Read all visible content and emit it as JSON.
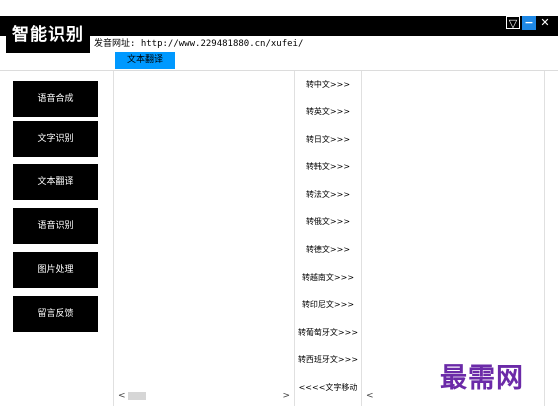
{
  "app": {
    "title": "智能识别"
  },
  "header": {
    "url_label": "发音网址: http://www.229481880.cn/xufei/"
  },
  "tab": {
    "label": "文本翻译"
  },
  "window_buttons": {
    "skin": "▽",
    "minimize": "−",
    "close": "✕"
  },
  "sidebar": {
    "items": [
      {
        "label": "语音合成"
      },
      {
        "label": "文字识别"
      },
      {
        "label": "文本翻译"
      },
      {
        "label": "语音识别"
      },
      {
        "label": "图片处理"
      },
      {
        "label": "留言反馈"
      }
    ]
  },
  "middle": {
    "buttons": [
      {
        "label": "转中文>>>"
      },
      {
        "label": "转英文>>>"
      },
      {
        "label": "转日文>>>"
      },
      {
        "label": "转韩文>>>"
      },
      {
        "label": "转法文>>>"
      },
      {
        "label": "转俄文>>>"
      },
      {
        "label": "转德文>>>"
      },
      {
        "label": "转越南文>>>"
      },
      {
        "label": "转印尼文>>>"
      },
      {
        "label": "转葡萄牙文>>>"
      },
      {
        "label": "转西班牙文>>>"
      },
      {
        "label": "<<<<文字移动"
      }
    ]
  },
  "scroll": {
    "left_arrow": "<",
    "right_arrow": ">"
  },
  "watermark": {
    "text": "最需网"
  },
  "colors": {
    "tab": "#0099ff",
    "button_bg": "#000000",
    "watermark": "#6b2aa8"
  }
}
